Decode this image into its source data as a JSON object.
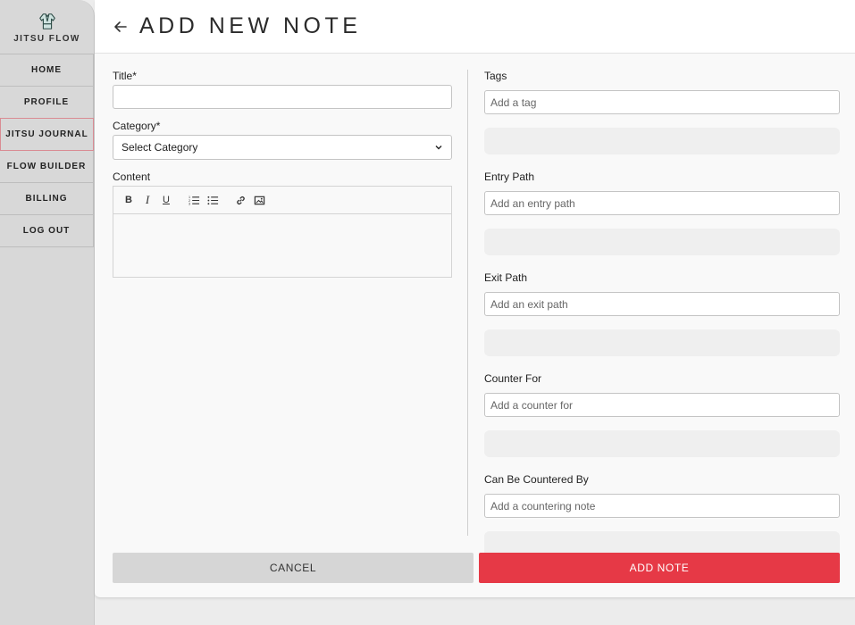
{
  "app": {
    "name": "JITSU FLOW"
  },
  "sidebar": {
    "items": [
      {
        "label": "HOME"
      },
      {
        "label": "PROFILE"
      },
      {
        "label": "JITSU JOURNAL",
        "active": true
      },
      {
        "label": "FLOW BUILDER"
      },
      {
        "label": "BILLING"
      },
      {
        "label": "LOG OUT"
      }
    ]
  },
  "header": {
    "title": "ADD NEW NOTE",
    "back_icon": "arrow-left-icon"
  },
  "form": {
    "title_label": "Title*",
    "title_value": "",
    "category_label": "Category*",
    "category_selected": "Select Category",
    "content_label": "Content",
    "toolbar": {
      "bold": "B",
      "italic": "I",
      "underline": "U",
      "ordered_list_icon": "ordered-list-icon",
      "bullet_list_icon": "bullet-list-icon",
      "link_icon": "link-icon",
      "image_icon": "image-icon"
    },
    "tags_label": "Tags",
    "tags_placeholder": "Add a tag",
    "entry_label": "Entry Path",
    "entry_placeholder": "Add an entry path",
    "exit_label": "Exit Path",
    "exit_placeholder": "Add an exit path",
    "counter_label": "Counter For",
    "counter_placeholder": "Add a counter for",
    "countered_label": "Can Be Countered By",
    "countered_placeholder": "Add a countering note"
  },
  "actions": {
    "cancel": "CANCEL",
    "add": "ADD NOTE"
  },
  "colors": {
    "accent": "#e63946",
    "sidebar": "#d8d8d8",
    "cancel": "#d6d6d6"
  }
}
